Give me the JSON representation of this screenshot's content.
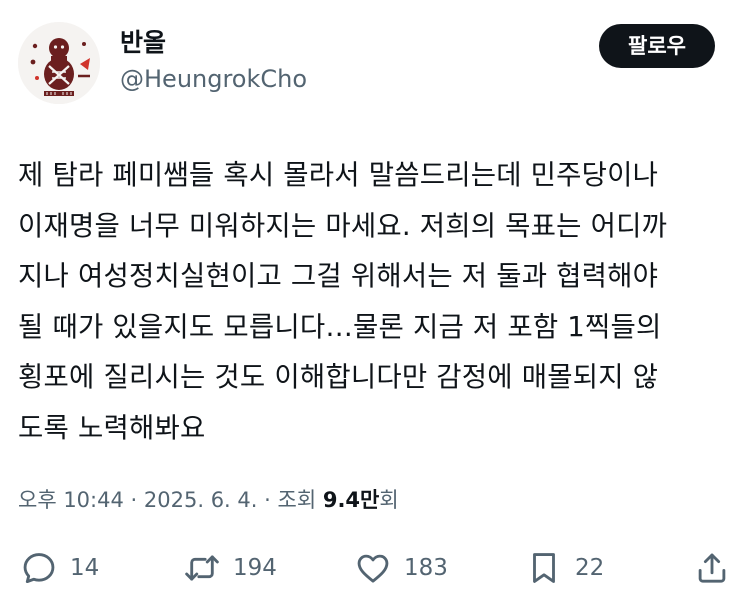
{
  "author": {
    "display_name": "반올",
    "handle": "@HeungrokCho",
    "avatar_icon": "gourd-figure-avatar-icon"
  },
  "follow_label": "팔로우",
  "tweet": {
    "lines": [
      "제 탐라 페미쌤들 혹시 몰라서 말씀드리는데 민주당이나",
      "이재명을 너무 미워하지는 마세요. 저희의 목표는 어디까",
      "지나 여성정치실현이고 그걸 위해서는 저 둘과 협력해야",
      "될 때가 있을지도 모릅니다…물론 지금 저 포함 1찍들의",
      "횡포에 질리시는 것도 이해합니다만 감정에 매몰되지 않",
      "도록 노력해봐요"
    ]
  },
  "meta": {
    "time": "오후 10:44",
    "separator": "·",
    "date": "2025. 6. 4.",
    "views_prefix": "조회",
    "views_number": "9.4만",
    "views_suffix": "회"
  },
  "actions": {
    "reply": {
      "icon": "reply-icon",
      "count": "14"
    },
    "retweet": {
      "icon": "retweet-icon",
      "count": "194"
    },
    "like": {
      "icon": "heart-icon",
      "count": "183"
    },
    "bookmark": {
      "icon": "bookmark-icon",
      "count": "22"
    },
    "share": {
      "icon": "share-icon"
    }
  },
  "colors": {
    "text_primary": "#0f1419",
    "text_secondary": "#536471",
    "follow_button_bg": "#0f1419",
    "follow_button_text": "#ffffff",
    "avatar_figure": "#6b1f1f"
  }
}
